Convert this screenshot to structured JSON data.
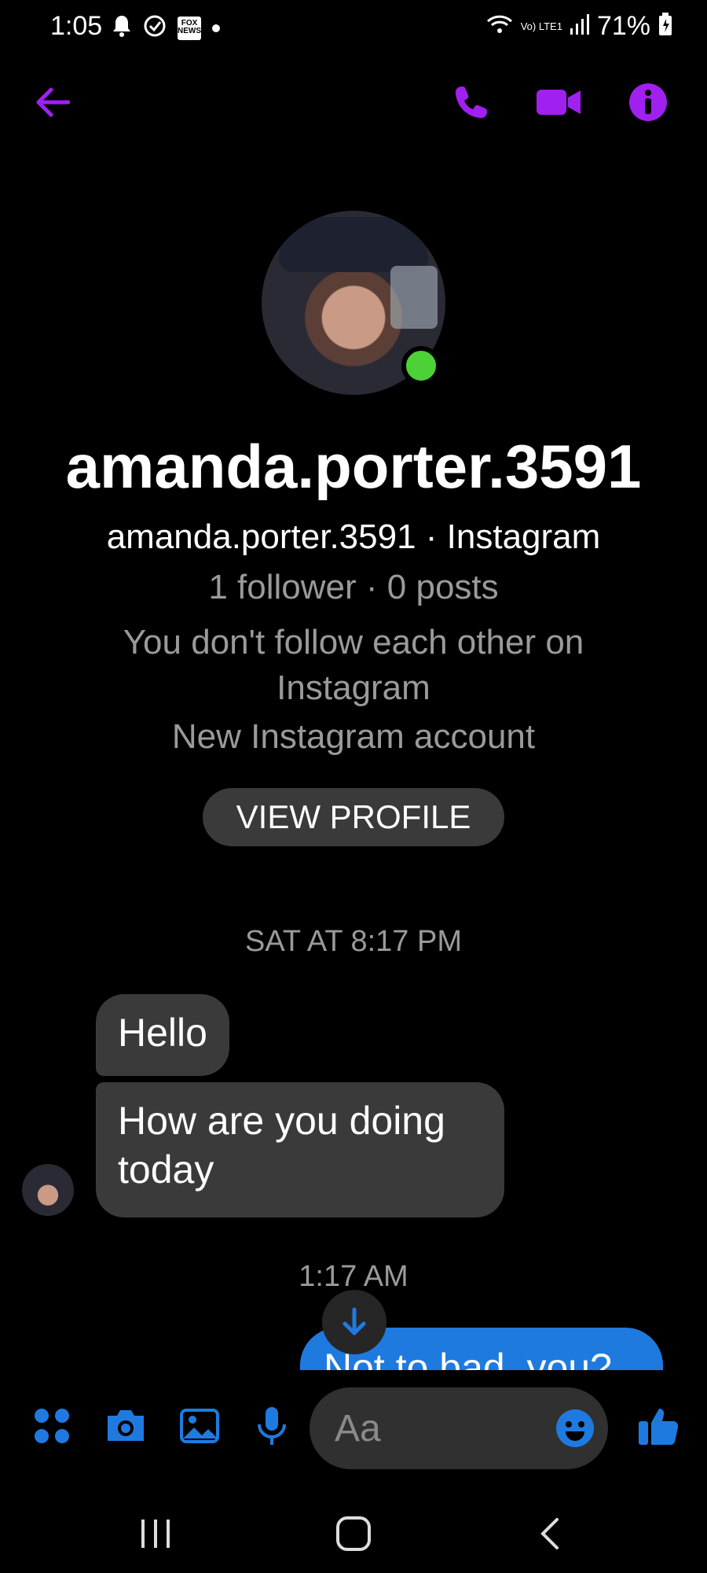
{
  "status_bar": {
    "time": "1:05",
    "notif_badge": "FOX NEWS",
    "network": "Vo) LTE1",
    "battery": "71%"
  },
  "header": {
    "back_icon": "arrow-left-icon",
    "call_icon": "phone-icon",
    "video_icon": "video-camera-icon",
    "info_icon": "info-icon",
    "accent": "#a020f0"
  },
  "profile": {
    "name": "amanda.porter.3591",
    "handle_line": "amanda.porter.3591 · Instagram",
    "stats_line": "1 follower · 0 posts",
    "follow_line": "You don't follow each other on Instagram",
    "account_line": "New Instagram account",
    "view_profile_label": "VIEW PROFILE",
    "online_color": "#4cd137"
  },
  "messages": {
    "timestamp1": "SAT AT 8:17 PM",
    "incoming": [
      "Hello",
      "How are you doing today"
    ],
    "timestamp2": "1:17 AM",
    "outgoing": [
      "Not to bad, you?"
    ]
  },
  "composer": {
    "placeholder": "Aa",
    "accent": "#1f7ae0"
  }
}
